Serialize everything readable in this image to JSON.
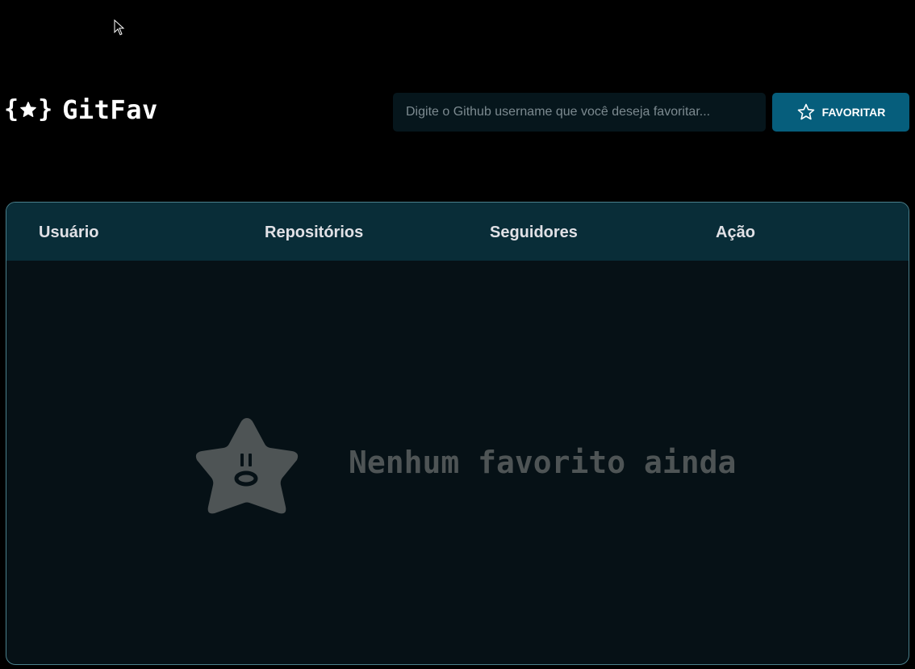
{
  "app": {
    "logo_text": "GitFav",
    "logo_brace_open": "{",
    "logo_brace_close": "}"
  },
  "search": {
    "placeholder": "Digite o Github username que você deseja favoritar...",
    "value": ""
  },
  "favorite_button": {
    "label": "FAVORITAR",
    "icon": "star-outline-icon"
  },
  "table": {
    "columns": [
      "Usuário",
      "Repositórios",
      "Seguidores",
      "Ação"
    ]
  },
  "empty_state": {
    "message": "Nenhum favorito ainda",
    "icon": "sad-star-icon"
  },
  "colors": {
    "background": "#000000",
    "button": "#065e7c",
    "table_header": "#092d38",
    "table_body": "#061116",
    "table_border": "#4a808c",
    "empty_text": "#4e5455"
  }
}
